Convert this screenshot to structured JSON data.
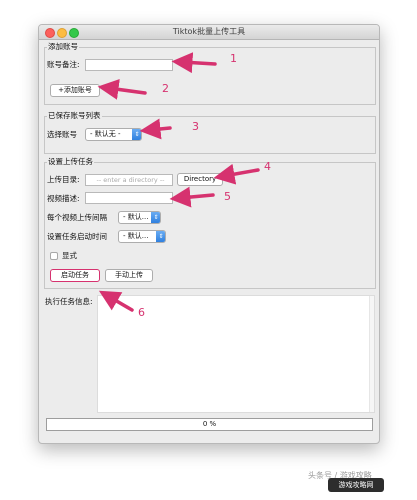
{
  "window": {
    "title": "Tiktok批量上传工具"
  },
  "add_account": {
    "group_label": "添加账号",
    "note_label": "账号备注:",
    "note_value": "",
    "add_button": "+添加账号"
  },
  "saved_accounts": {
    "group_label": "已保存账号列表",
    "select_label": "选择账号",
    "select_value": "- 默认无 -"
  },
  "upload_task": {
    "group_label": "设置上传任务",
    "dir_label": "上传目录:",
    "dir_placeholder": "-- enter a directory --",
    "dir_button": "Directory",
    "desc_label": "视频描述:",
    "desc_value": "",
    "interval_label": "每个视频上传间隔",
    "interval_value": "- 默认...",
    "start_time_label": "设置任务启动时间",
    "start_time_value": "- 默认...",
    "show_label": "显式",
    "start_button": "启动任务",
    "manual_button": "手动上传"
  },
  "log": {
    "label": "执行任务信息:"
  },
  "progress": {
    "text": "0 %",
    "value": 0
  },
  "annotations": [
    "1",
    "2",
    "3",
    "4",
    "5",
    "6"
  ],
  "watermark": {
    "text": "头条号 / 游戏攻略",
    "logo": "游戏攻略网"
  },
  "colors": {
    "accent": "#d6326f",
    "select_blue": "#2a7cdd"
  }
}
